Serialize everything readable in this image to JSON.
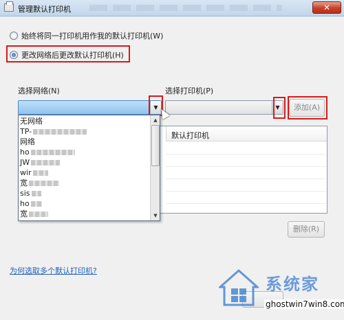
{
  "window": {
    "title": "管理默认打印机",
    "close_label": "✕"
  },
  "options": {
    "always_same": "始终将同一打印机用作我的默认打印机(W)",
    "change_on_network": "更改网络后更改默认打印机(H)",
    "selected": "change_on_network"
  },
  "network": {
    "label": "选择网络(N)",
    "items": [
      {
        "text": "无网络"
      },
      {
        "text": "TP-"
      },
      {
        "text": "网络"
      },
      {
        "text": "ho"
      },
      {
        "text": "JW"
      },
      {
        "text": "wir"
      },
      {
        "text": "宽"
      },
      {
        "text": "sis"
      },
      {
        "text": "ho"
      },
      {
        "text": "宽"
      }
    ]
  },
  "printer": {
    "label": "选择打印机(P)",
    "add_label": "添加(A)",
    "column_header": "默认打印机",
    "delete_label": "删除(R)"
  },
  "help": {
    "link_text": "为何选取多个默认打印机?"
  },
  "watermark": {
    "cn_text": "系统家",
    "url": "ghostwin7win8.com"
  },
  "colors": {
    "highlight_red": "#d81818",
    "accent_blue": "#1f5fbf"
  }
}
